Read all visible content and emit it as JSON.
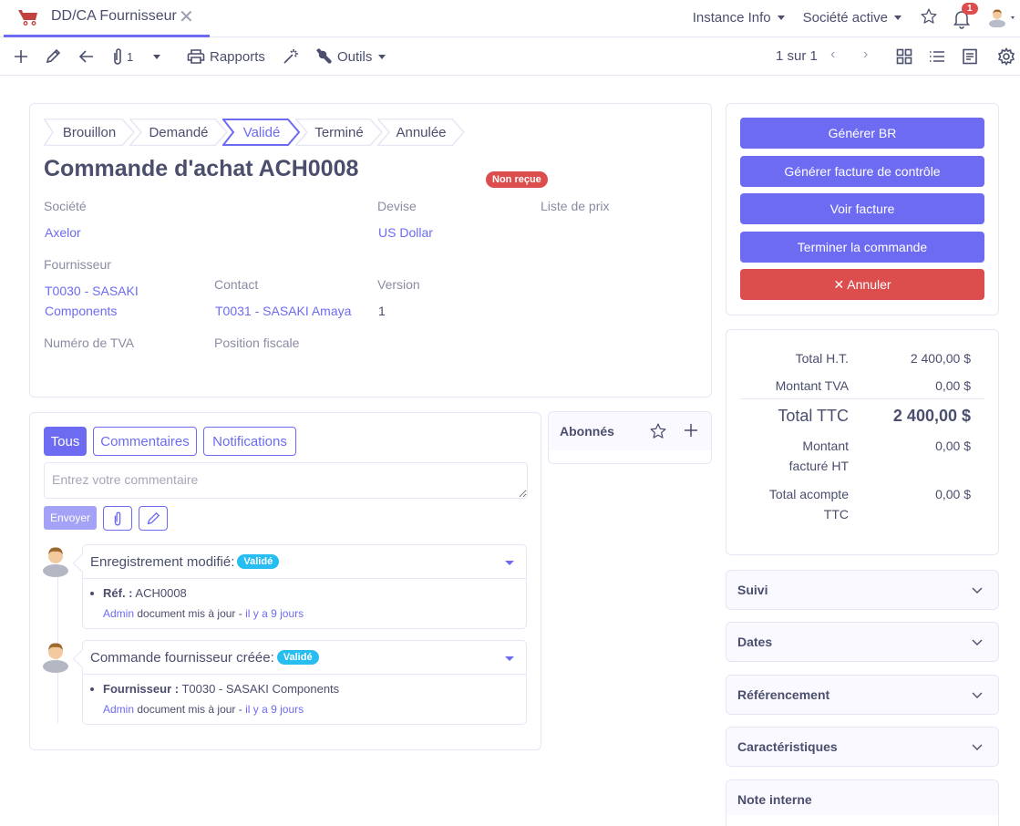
{
  "colors": {
    "accent": "#6d6bf2",
    "danger": "#dc4d4d",
    "info": "#27bdf0",
    "text": "#4b4e6d",
    "muted": "#8a8ca3",
    "border": "#e6e6f5"
  },
  "topbar": {
    "tab_icon": "shopping-cart-icon",
    "tab_title": "DD/CA Fournisseur",
    "instance_info": "Instance Info",
    "active_company": "Société active",
    "notification_count": "1"
  },
  "toolbar": {
    "attachment_count": "1",
    "reports_label": "Rapports",
    "tools_label": "Outils",
    "pager_text": "1 sur 1"
  },
  "record": {
    "steps": [
      {
        "label": "Brouillon",
        "active": false
      },
      {
        "label": "Demandé",
        "active": false
      },
      {
        "label": "Validé",
        "active": true
      },
      {
        "label": "Terminé",
        "active": false
      },
      {
        "label": "Annulée",
        "active": false
      }
    ],
    "title": "Commande d'achat ACH0008",
    "status_badge": "Non reçue",
    "fields": {
      "company_label": "Société",
      "company_value": "Axelor",
      "currency_label": "Devise",
      "currency_value": "US Dollar",
      "price_list_label": "Liste de prix",
      "supplier_label": "Fournisseur",
      "supplier_value_line1": "T0030 - SASAKI",
      "supplier_value_line2": "Components",
      "contact_label": "Contact",
      "contact_value": "T0031 - SASAKI Amaya",
      "version_label": "Version",
      "version_value": "1",
      "vat_number_label": "Numéro de TVA",
      "fiscal_position_label": "Position fiscale"
    }
  },
  "actions": [
    {
      "label": "Générer BR",
      "style": "primary"
    },
    {
      "label": "Générer facture de contrôle",
      "style": "primary"
    },
    {
      "label": "Voir facture",
      "style": "primary"
    },
    {
      "label": "Terminer la commande",
      "style": "primary"
    },
    {
      "label": "✕ Annuler",
      "style": "danger"
    }
  ],
  "totals": {
    "total_ht_label": "Total H.T.",
    "total_ht_value": "2 400,00 $",
    "vat_label": "Montant TVA",
    "vat_value": "0,00 $",
    "total_ttc_label": "Total TTC",
    "total_ttc_value": "2 400,00 $",
    "invoiced_ht_label_1": "Montant",
    "invoiced_ht_label_2": "facturé HT",
    "invoiced_ht_value": "0,00 $",
    "advance_label_1": "Total acompte",
    "advance_label_2": "TTC",
    "advance_value": "0,00 $"
  },
  "panels": [
    {
      "title": "Suivi",
      "collapsible": true
    },
    {
      "title": "Dates",
      "collapsible": true
    },
    {
      "title": "Référencement",
      "collapsible": true
    },
    {
      "title": "Caractéristiques",
      "collapsible": true
    },
    {
      "title": "Note interne",
      "collapsible": false
    }
  ],
  "messages": {
    "filters": [
      {
        "label": "Tous",
        "active": true
      },
      {
        "label": "Commentaires",
        "active": false
      },
      {
        "label": "Notifications",
        "active": false
      }
    ],
    "comment_placeholder": "Entrez votre commentaire",
    "send_label": "Envoyer",
    "items": [
      {
        "title": "Enregistrement modifié:",
        "tag": "Validé",
        "field_label": "Réf. :",
        "field_value": "ACH0008",
        "author": "Admin",
        "action": "document mis à jour -",
        "time": "il y a 9 jours"
      },
      {
        "title": "Commande fournisseur créée:",
        "tag": "Validé",
        "field_label": "Fournisseur :",
        "field_value": "T0030 - SASAKI Components",
        "author": "Admin",
        "action": "document mis à jour -",
        "time": "il y a 9 jours"
      }
    ]
  },
  "followers": {
    "title": "Abonnés"
  }
}
